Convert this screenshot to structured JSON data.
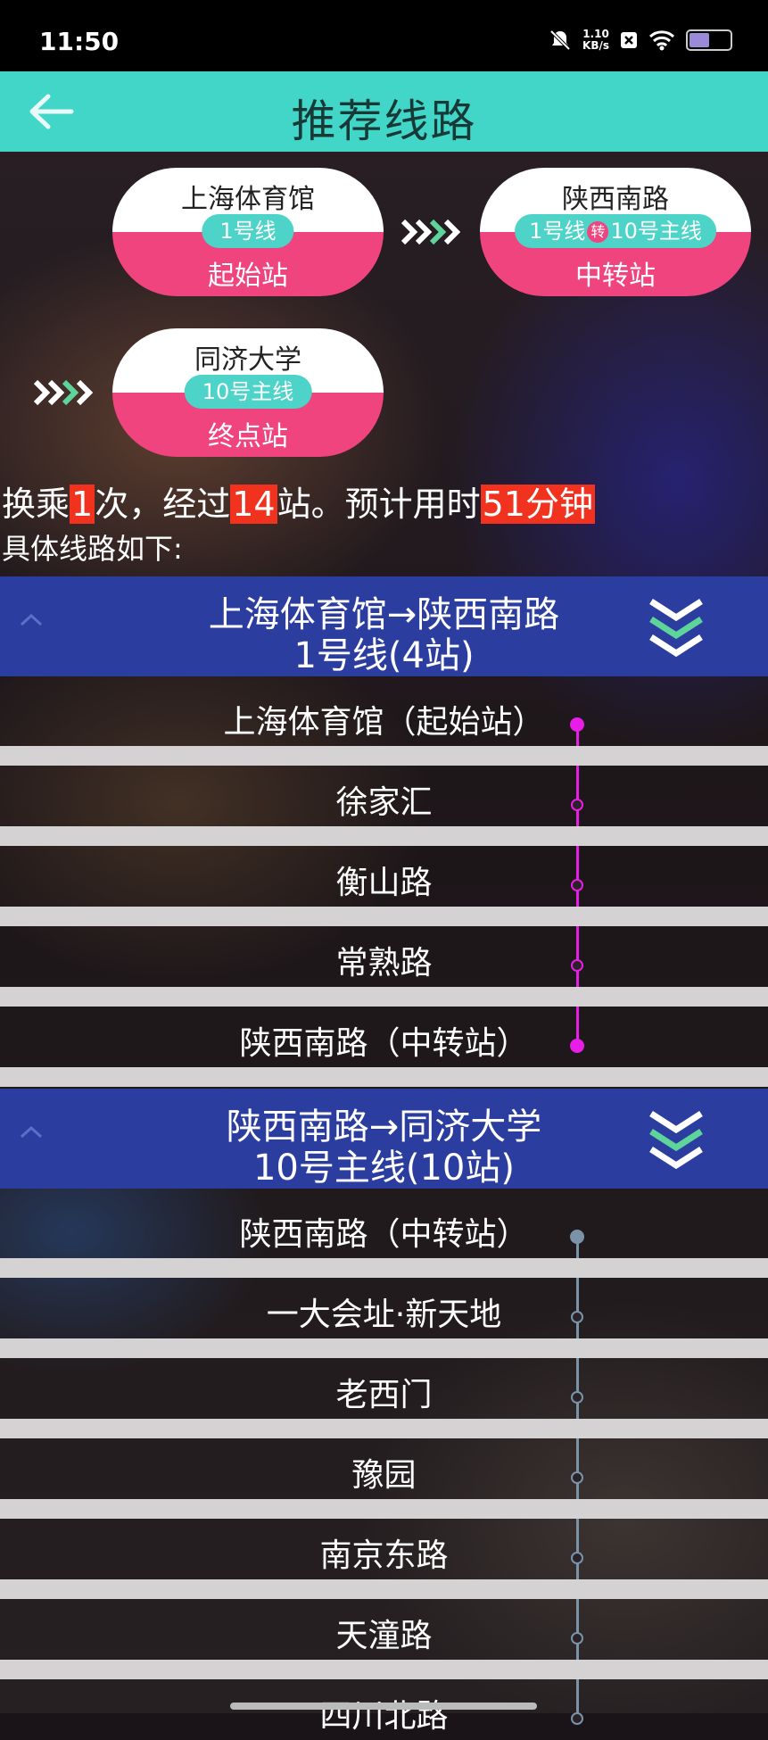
{
  "status_bar": {
    "time": "11:50",
    "net_speed_value": "1.10",
    "net_speed_unit": "KB/s"
  },
  "header": {
    "title": "推荐线路"
  },
  "route_cards": [
    {
      "name": "上海体育馆",
      "line": "1号线",
      "role": "起始站"
    },
    {
      "name": "陕西南路",
      "line_from": "1号线",
      "transfer": "转",
      "line_to": "10号主线",
      "role": "中转站"
    },
    {
      "name": "同济大学",
      "line": "10号主线",
      "role": "终点站"
    }
  ],
  "summary": {
    "p1": "换乘",
    "transfers": "1",
    "p2": "次，经过",
    "stations": "14",
    "p3": "站。预计用时",
    "duration": "51分钟",
    "detail_label": "具体线路如下:"
  },
  "segments": [
    {
      "title": "上海体育馆→陕西南路",
      "subtitle": "1号线(4站)",
      "line_color": "#e61ee6",
      "stations": [
        "上海体育馆（起始站）",
        "徐家汇",
        "衡山路",
        "常熟路",
        "陕西南路（中转站）"
      ]
    },
    {
      "title": "陕西南路→同济大学",
      "subtitle": "10号主线(10站)",
      "line_color": "#7a93a8",
      "stations": [
        "陕西南路（中转站）",
        "一大会址·新天地",
        "老西门",
        "豫园",
        "南京东路",
        "天潼路",
        "四川北路"
      ]
    }
  ],
  "colors": {
    "accent": "#42d6c8",
    "segment_header": "#2b3ea0",
    "pink": "#f0447e",
    "highlight": "#f0321e"
  }
}
